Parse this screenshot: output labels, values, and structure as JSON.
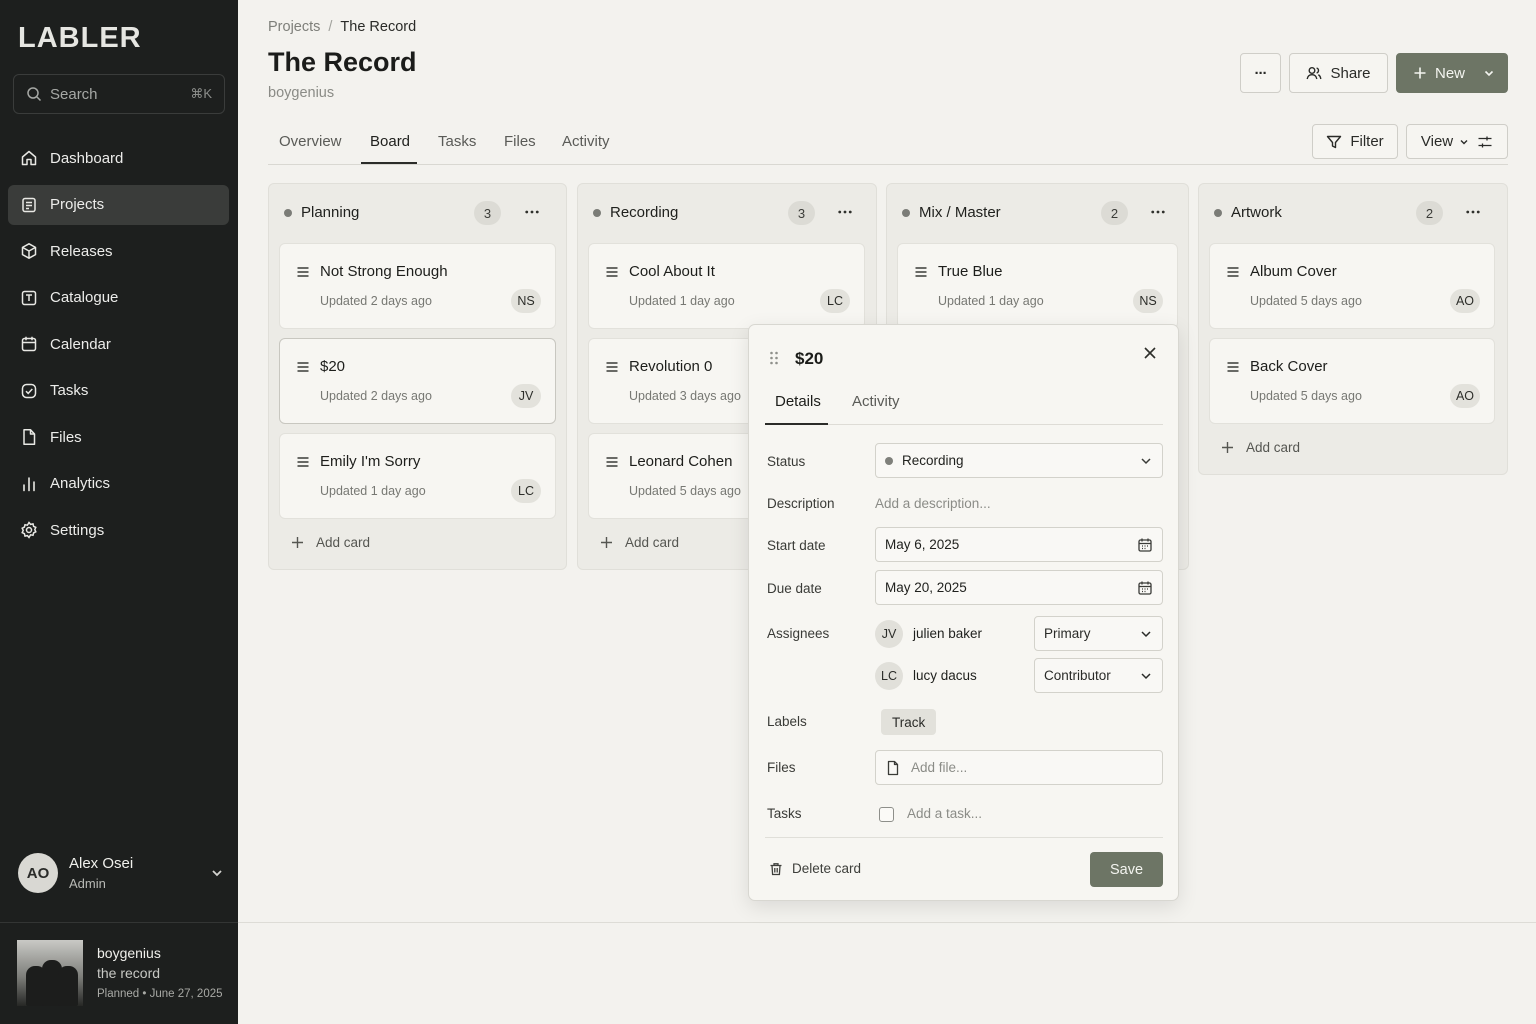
{
  "app": {
    "name": "LABLER"
  },
  "search": {
    "placeholder": "Search",
    "shortcut": "⌘K"
  },
  "nav": [
    {
      "label": "Dashboard",
      "icon": "home-icon"
    },
    {
      "label": "Projects",
      "icon": "projects-icon",
      "active": true
    },
    {
      "label": "Releases",
      "icon": "release-box-icon"
    },
    {
      "label": "Catalogue",
      "icon": "catalogue-icon"
    },
    {
      "label": "Calendar",
      "icon": "calendar-icon"
    },
    {
      "label": "Tasks",
      "icon": "check-circle-icon"
    },
    {
      "label": "Files",
      "icon": "file-icon"
    },
    {
      "label": "Analytics",
      "icon": "bar-chart-icon"
    },
    {
      "label": "Settings",
      "icon": "gear-icon"
    }
  ],
  "user": {
    "initials": "AO",
    "name": "Alex Osei",
    "role": "Admin"
  },
  "now_playing": {
    "artist": "boygenius",
    "title": "the record",
    "status": "Planned • June 27, 2025"
  },
  "breadcrumb": {
    "parent": "Projects",
    "separator": "/",
    "current": "The Record"
  },
  "header": {
    "title": "The Record",
    "subtitle": "boygenius",
    "more_label": "···",
    "share_label": "Share",
    "new_label": "New"
  },
  "tabs": [
    {
      "label": "Overview"
    },
    {
      "label": "Board",
      "active": true
    },
    {
      "label": "Tasks"
    },
    {
      "label": "Files"
    },
    {
      "label": "Activity"
    }
  ],
  "toolbar": {
    "filter_label": "Filter",
    "view_label": "View"
  },
  "board": {
    "add_card_label": "Add card",
    "columns": [
      {
        "title": "Planning",
        "count": "3",
        "cards": [
          {
            "title": "Not Strong Enough",
            "updated": "Updated 2 days ago",
            "assignee": "NS"
          },
          {
            "title": "$20",
            "updated": "Updated 2 days ago",
            "assignee": "JV"
          },
          {
            "title": "Emily I'm Sorry",
            "updated": "Updated 1 day ago",
            "assignee": "LC"
          }
        ]
      },
      {
        "title": "Recording",
        "count": "3",
        "cards": [
          {
            "title": "Cool About It",
            "updated": "Updated 1 day ago",
            "assignee": "LC"
          },
          {
            "title": "Revolution 0",
            "updated": "Updated 3 days ago",
            "assignee": ""
          },
          {
            "title": "Leonard Cohen",
            "updated": "Updated 5 days ago",
            "assignee": ""
          }
        ]
      },
      {
        "title": "Mix / Master",
        "count": "2",
        "cards": [
          {
            "title": "True Blue",
            "updated": "Updated 1 day ago",
            "assignee": "NS"
          }
        ]
      },
      {
        "title": "Artwork",
        "count": "2",
        "cards": [
          {
            "title": "Album Cover",
            "updated": "Updated 5 days ago",
            "assignee": "AO"
          },
          {
            "title": "Back Cover",
            "updated": "Updated 5 days ago",
            "assignee": "AO"
          }
        ]
      }
    ]
  },
  "panel": {
    "title": "$20",
    "tabs": [
      {
        "label": "Details",
        "active": true
      },
      {
        "label": "Activity"
      }
    ],
    "fields": {
      "status_label": "Status",
      "status_value": "Recording",
      "description_label": "Description",
      "description_placeholder": "Add a description...",
      "start_label": "Start date",
      "start_value": "May 6, 2025",
      "due_label": "Due date",
      "due_value": "May 20, 2025",
      "assignees_label": "Assignees",
      "assignees": [
        {
          "initials": "JV",
          "name": "julien baker",
          "role": "Primary"
        },
        {
          "initials": "LC",
          "name": "lucy dacus",
          "role": "Contributor"
        }
      ],
      "labels_label": "Labels",
      "label_chip": "Track",
      "files_label": "Files",
      "files_placeholder": "Add file...",
      "tasks_label": "Tasks",
      "tasks_placeholder": "Add a task..."
    },
    "delete_label": "Delete card",
    "save_label": "Save"
  },
  "colors": {
    "sidebar_bg": "#1d1f1e",
    "accent": "#6d7565",
    "page_bg": "#f3f2ee"
  }
}
